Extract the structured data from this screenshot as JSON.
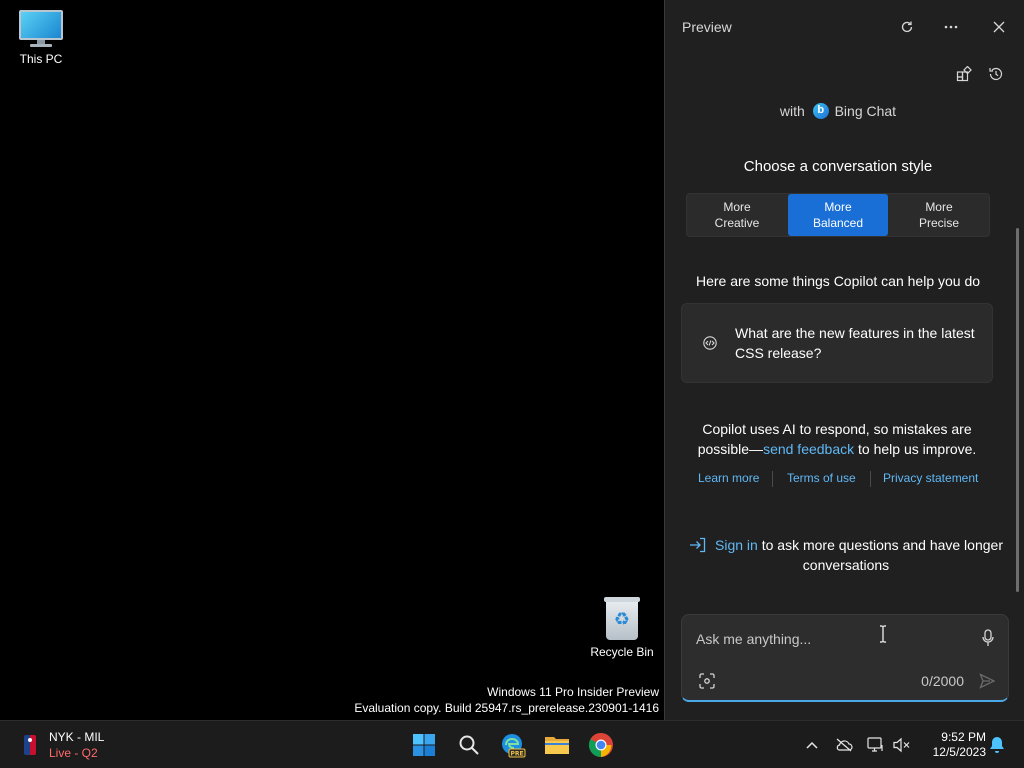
{
  "desktop": {
    "icons": [
      {
        "label": "This PC"
      },
      {
        "label": "Recycle Bin"
      }
    ],
    "watermark": {
      "line1": "Windows 11 Pro Insider Preview",
      "line2": "Evaluation copy. Build 25947.rs_prerelease.230901-1416"
    }
  },
  "panel": {
    "title": "Preview",
    "icons": {
      "refresh": "refresh-icon",
      "more": "more-options-icon",
      "close": "close-icon",
      "plugins": "plugins-icon",
      "history": "history-icon"
    },
    "with_label": "with",
    "bing_label": "Bing Chat",
    "style_heading": "Choose a conversation style",
    "styles": [
      {
        "line1": "More",
        "line2": "Creative",
        "selected": false
      },
      {
        "line1": "More",
        "line2": "Balanced",
        "selected": true
      },
      {
        "line1": "More",
        "line2": "Precise",
        "selected": false
      }
    ],
    "accent_color": "#1a6fd6",
    "help_heading": "Here are some things Copilot can help you do",
    "suggestion": {
      "icon": "code-icon",
      "text": "What are the new features in the latest CSS release?"
    },
    "disclaimer": {
      "text_before": "Copilot uses AI to respond, so mistakes are possible—",
      "link": "send feedback",
      "text_after": " to help us improve."
    },
    "links": {
      "learn_more": "Learn more",
      "terms": "Terms of use",
      "privacy": "Privacy statement"
    },
    "signin": {
      "link": "Sign in",
      "text": " to ask more questions and have longer conversations"
    },
    "composer": {
      "placeholder": "Ask me anything...",
      "value": "",
      "char_count": "0/2000"
    }
  },
  "taskbar": {
    "widget": {
      "title": "NYK - MIL",
      "status": "Live - Q2"
    },
    "apps": [
      "start-button",
      "search-button",
      "edge-pre",
      "file-explorer",
      "chrome"
    ],
    "clock": {
      "time": "9:52 PM",
      "date": "12/5/2023"
    }
  }
}
